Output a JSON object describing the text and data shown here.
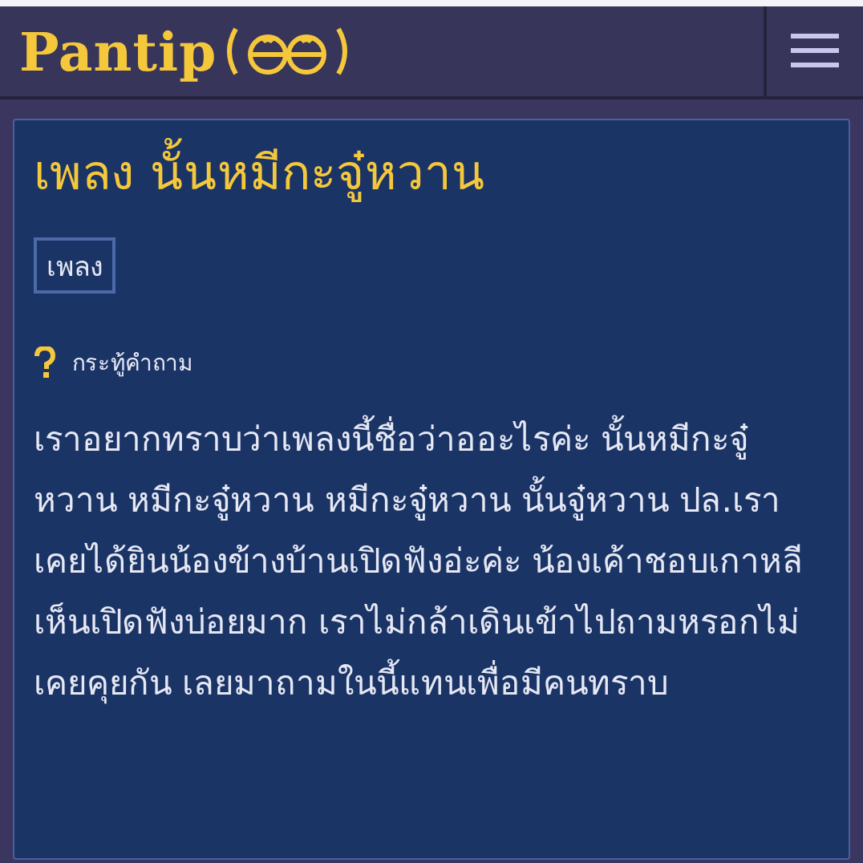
{
  "header": {
    "logo_text": "Pantip"
  },
  "topic": {
    "title": "เพลง นั้นหมีกะจู๋หวาน",
    "tags": [
      "เพลง"
    ],
    "type_label": "กระทู้คำถาม",
    "body": "เราอยากทราบว่าเพลงนี้ชื่อว่าออะไรค่ะ นั้นหมีกะจู๋หวาน หมีกะจู๋หวาน หมีกะจู๋หวาน นั้นจู๋หวาน ปล.เราเคยได้ยินน้องข้างบ้านเปิดฟังอ่ะค่ะ น้องเค้าชอบเกาหลีเห็นเปิดฟังบ่อยมาก เราไม่กล้าเดินเข้าไปถามหรอกไม่เคยคุยกัน เลยมาถามในนี้แทนเพื่อมีคนทราบ"
  }
}
